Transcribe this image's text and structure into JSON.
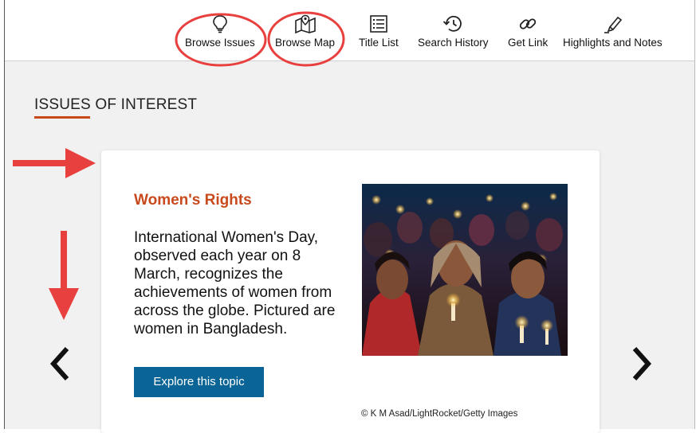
{
  "toolbar": {
    "items": [
      {
        "label": "Browse Issues",
        "icon": "lightbulb-icon"
      },
      {
        "label": "Browse Map",
        "icon": "map-pin-icon"
      },
      {
        "label": "Title List",
        "icon": "list-icon"
      },
      {
        "label": "Search History",
        "icon": "history-icon"
      },
      {
        "label": "Get Link",
        "icon": "link-icon"
      },
      {
        "label": "Highlights and Notes",
        "icon": "highlighter-icon"
      }
    ]
  },
  "section": {
    "title": "ISSUES OF INTEREST"
  },
  "card": {
    "title": "Women's Rights",
    "description": "International Women's Day, observed each year on 8 March, recognizes the achievements of women from across the globe. Pictured are women in Bangladesh.",
    "button_label": "Explore this topic",
    "photo_credit": "© K M Asad/LightRocket/Getty Images"
  },
  "carousel": {
    "prev_icon": "chevron-left-icon",
    "next_icon": "chevron-right-icon"
  },
  "colors": {
    "accent": "#c8491c",
    "button": "#0a6496",
    "annotation": "#e8403f"
  }
}
